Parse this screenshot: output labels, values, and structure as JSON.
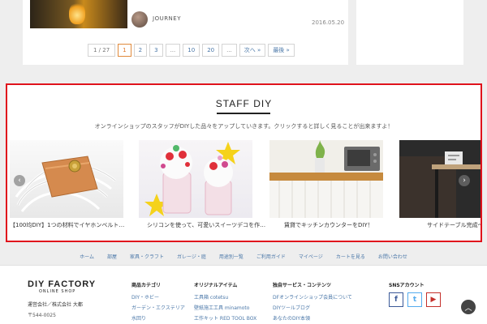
{
  "post": {
    "author": "JOURNEY",
    "date": "2016.05.20"
  },
  "pagination": {
    "status": "1 / 27",
    "pages": [
      "1",
      "2",
      "3",
      "...",
      "10",
      "20",
      "..."
    ],
    "current": "1",
    "next": "次へ »",
    "last": "最後 »"
  },
  "staff": {
    "title": "STAFF DIY",
    "description": "オンラインショップのスタッフがDIYした品々をアップしていきます。クリックすると詳しく見ることが出来ますよ！",
    "slides": [
      {
        "caption": "【100均DIY】1つの材料でイヤホンベルト…"
      },
      {
        "caption": "シリコンを使って、可愛いスイーツデコを作…"
      },
      {
        "caption": "賃貸でキッチンカウンターをDIY！"
      },
      {
        "caption": "サイドテーブル完成〜"
      }
    ],
    "prev_icon": "chevron-left-icon",
    "next_icon": "chevron-right-icon"
  },
  "footer_nav": [
    "ホーム",
    "部屋",
    "家具・クラフト",
    "ガレージ・庭",
    "用途別一覧",
    "ご利用ガイド",
    "マイページ",
    "カートを見る",
    "お問い合わせ"
  ],
  "footer": {
    "logo": "DIY FACTORY",
    "logo_sub": "ONLINE SHOP",
    "company": "運営会社／株式会社 大都",
    "postal": "〒544-0025",
    "columns": [
      {
        "title": "商品カテゴリ",
        "links": [
          "DIY・ホビー",
          "ガーデン・エクステリア",
          "水回り"
        ]
      },
      {
        "title": "オリジナルアイテム",
        "links": [
          "工具箱 cotetsu",
          "壁紙施工工具 minamoto",
          "工作キット RED TOOL BOX"
        ]
      },
      {
        "title": "独自サービス・コンテンツ",
        "links": [
          "DFオンラインショップ会員について",
          "DIYツールブログ",
          "あなたのDIY本領"
        ]
      }
    ],
    "sns_title": "SNSアカウント",
    "sns": {
      "facebook": "f",
      "twitter": "t",
      "youtube": "▶"
    }
  },
  "colors": {
    "highlight_border": "#e0131c",
    "link": "#4a77a8",
    "current_page": "#e0782c"
  }
}
